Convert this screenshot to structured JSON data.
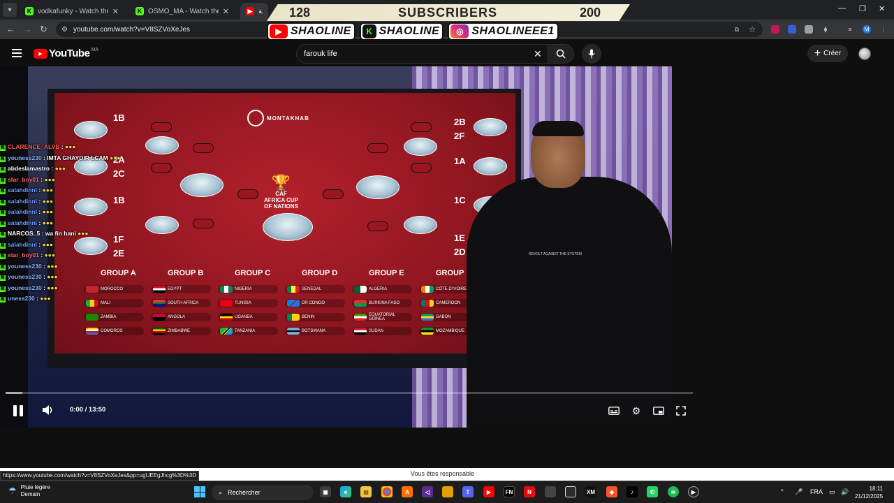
{
  "browser": {
    "tabs": [
      {
        "title": "vodkafunky - Watch the VOD o",
        "favicon": "kick-icon",
        "active": false
      },
      {
        "title": "OSMO_MA - Watch the VOD o",
        "favicon": "kick-icon",
        "active": false
      },
      {
        "title": "بطولة",
        "favicon": "youtube-icon",
        "active": true
      }
    ],
    "url": "youtube.com/watch?v=V8SZVoXeJes",
    "status_url": "https://www.youtube.com/watch?v=V8SZVoXeJes&pp=ugUEEgJhcg%3D%3D"
  },
  "overlay": {
    "count_left": "128",
    "label": "SUBSCRIBERS",
    "count_right": "200",
    "socials": [
      {
        "platform": "youtube-icon",
        "handle": "SHAOLINE"
      },
      {
        "platform": "kick-icon",
        "handle": "SHAOLINE"
      },
      {
        "platform": "instagram-icon",
        "handle": "SHAOLINEEE1"
      }
    ]
  },
  "youtube": {
    "logo_text": "YouTube",
    "country_code": "MA",
    "search_value": "farouk life",
    "create_label": "Créer"
  },
  "video": {
    "brand": "MONTAKHAB",
    "cup_lines": [
      "CAF",
      "AFRICA CUP",
      "OF NATIONS"
    ],
    "seeds_left": [
      "1B",
      "2A",
      "2C",
      "1B",
      "1F",
      "2E"
    ],
    "seeds_right": [
      "2B",
      "2F",
      "1A",
      "1C",
      "1E",
      "2D"
    ],
    "groups": [
      {
        "name": "GROUP A",
        "teams": [
          "MOROCCO",
          "MALI",
          "ZAMBIA",
          "COMOROS"
        ]
      },
      {
        "name": "GROUP B",
        "teams": [
          "EGYPT",
          "SOUTH AFRICA",
          "ANGOLA",
          "ZIMBABWE"
        ]
      },
      {
        "name": "GROUP C",
        "teams": [
          "NIGERIA",
          "TUNISIA",
          "UGANDA",
          "TANZANIA"
        ]
      },
      {
        "name": "GROUP D",
        "teams": [
          "SENEGAL",
          "DR CONGO",
          "BENIN",
          "BOTSWANA"
        ]
      },
      {
        "name": "GROUP E",
        "teams": [
          "ALGERIA",
          "BURKINA FASO",
          "EQUATORIAL GUINEA",
          "SUDAN"
        ]
      },
      {
        "name": "GROUP F",
        "teams": [
          "CÔTE D'IVOIRE",
          "CAMEROON",
          "GABON",
          "MOZAMBIQUE"
        ]
      }
    ],
    "hoodie_print": "REVOLT AGAINST THE SYSTEM",
    "time_display": "0:00 / 13:50",
    "progress_fraction": 0
  },
  "chat": [
    {
      "user": "CLARENCE_ALVB",
      "msg": "",
      "color": "#ff5a5a"
    },
    {
      "user": "youness230",
      "msg": "IMTA GHAYDIR LCAM",
      "color": "#8ab4ff"
    },
    {
      "user": "abdeslamastro",
      "msg": "",
      "color": "#ffffff"
    },
    {
      "user": "star_boy01",
      "msg": "",
      "color": "#ff6a6a"
    },
    {
      "user": "salahdinnl",
      "msg": "",
      "color": "#6f9bff"
    },
    {
      "user": "salahdinnl",
      "msg": "",
      "color": "#6f9bff"
    },
    {
      "user": "salahdinnl",
      "msg": "",
      "color": "#6f9bff"
    },
    {
      "user": "salahdinnl",
      "msg": "",
      "color": "#6f9bff"
    },
    {
      "user": "NARCOS_5",
      "msg": "wa fin hani",
      "color": "#ffffff"
    },
    {
      "user": "salahdinnl",
      "msg": "",
      "color": "#6f9bff"
    },
    {
      "user": "star_boy01",
      "msg": "",
      "color": "#ff6a6a"
    },
    {
      "user": "youness230",
      "msg": "",
      "color": "#8ab4ff"
    },
    {
      "user": "youness230",
      "msg": "",
      "color": "#8ab4ff"
    },
    {
      "user": "youness230",
      "msg": "",
      "color": "#8ab4ff"
    },
    {
      "user": "uness230",
      "msg": "",
      "color": "#8ab4ff"
    }
  ],
  "download_notice": "Vous êtes responsable",
  "taskbar": {
    "weather_line1": "Pluie légère",
    "weather_line2": "Demain",
    "search_placeholder": "Rechercher",
    "lang": "FRA",
    "time": "18:11",
    "date": "21/12/2025"
  },
  "colors": {
    "accent": "#ff0000",
    "kick_green": "#53fc18",
    "screen_red": "#a31b26"
  }
}
